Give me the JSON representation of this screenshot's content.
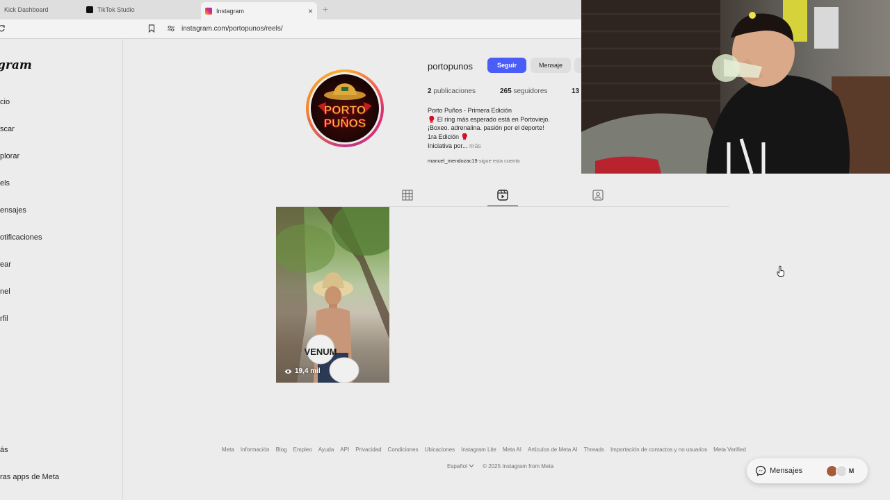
{
  "browser": {
    "tabs": [
      {
        "title": "Kick Dashboard"
      },
      {
        "title": "TikTok Studio"
      },
      {
        "title": "Instagram"
      }
    ],
    "url": "instagram.com/portopunos/reels/"
  },
  "sidebar": {
    "logo_text": "gram",
    "items": [
      {
        "label": "cio"
      },
      {
        "label": "scar"
      },
      {
        "label": "plorar"
      },
      {
        "label": "els"
      },
      {
        "label": "ensajes"
      },
      {
        "label": "otificaciones"
      },
      {
        "label": "ear"
      },
      {
        "label": "nel"
      },
      {
        "label": "rfil"
      }
    ],
    "bottom_items": [
      {
        "label": "ás"
      },
      {
        "label": "ras apps de Meta"
      }
    ]
  },
  "profile": {
    "username": "portopunos",
    "follow_label": "Seguir",
    "message_label": "Mensaje",
    "stats": {
      "posts_count": "2",
      "posts_label": "publicaciones",
      "followers_count": "265",
      "followers_label": "seguidores",
      "following_count": "13"
    },
    "avatar_text": [
      "PORTO",
      "PUÑOS"
    ],
    "bio": {
      "name": "Porto Puños - Primera Edición",
      "line1": "🥊 El ring más esperado está en Portoviejo.",
      "line2": "¡Boxeo. adrenalina. pasión por el deporte!",
      "line3": "1ra Edición 🥊",
      "line4": "Iniciativa por...",
      "more": "más"
    },
    "followed_by_user": "manuel_mendozac19",
    "followed_by_suffix": "sigue esta cuenta"
  },
  "reel": {
    "views": "19,4 mil",
    "glove_text": "VENUM"
  },
  "footer": {
    "links": [
      "Meta",
      "Información",
      "Blog",
      "Empleo",
      "Ayuda",
      "API",
      "Privacidad",
      "Condiciones",
      "Ubicaciones",
      "Instagram Lite",
      "Meta AI",
      "Artículos de Meta AI",
      "Threads",
      "Importación de contactos y no usuarios",
      "Meta Verified"
    ],
    "language": "Español",
    "copyright": "© 2025 Instagram from Meta"
  },
  "messages_pill": {
    "label": "Mensajes",
    "avatar_letter": "M"
  },
  "colors": {
    "follow_button": "#4a5df9",
    "background": "#ececec"
  }
}
